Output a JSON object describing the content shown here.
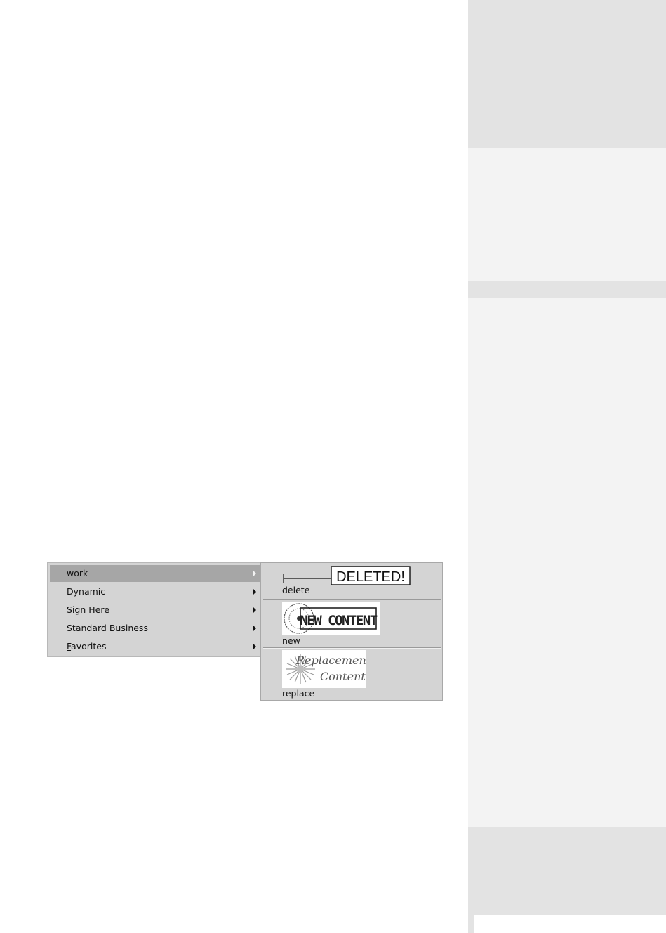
{
  "menu": {
    "items": [
      {
        "label": "work",
        "has_submenu": true,
        "active": true
      },
      {
        "label": "Dynamic",
        "has_submenu": true
      },
      {
        "label": "Sign Here",
        "has_submenu": true
      },
      {
        "label": "Standard Business",
        "has_submenu": true
      },
      {
        "label": "Favorites",
        "has_submenu": true,
        "mnemonic": "F"
      }
    ]
  },
  "submenu": {
    "items": [
      {
        "label": "delete",
        "stamp_text": "DELETED!"
      },
      {
        "label": "new",
        "stamp_text": "NEW CONTENT"
      },
      {
        "label": "replace",
        "stamp_text": "Replacement Content"
      }
    ]
  },
  "colors": {
    "menu_bg": "#d4d4d4",
    "highlight": "#a6a6a6",
    "margin_band_dark": "#e3e3e3",
    "margin_band_light": "#f3f3f3"
  }
}
